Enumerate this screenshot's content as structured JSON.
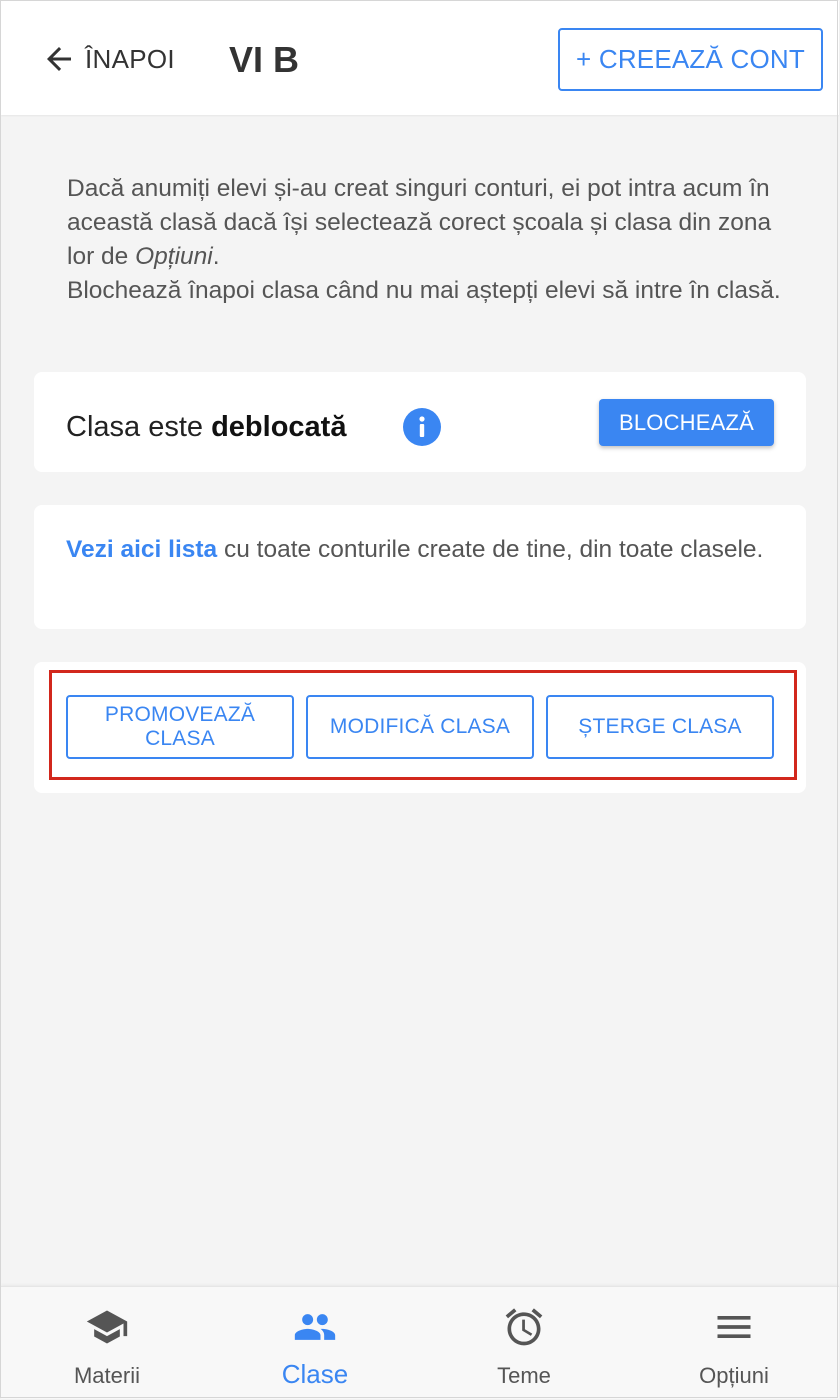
{
  "header": {
    "back_label": "ÎNAPOI",
    "title": "VI B",
    "create_account_label": "+ CREEAZĂ CONT",
    "back_icon": "arrow-left-icon"
  },
  "intro": {
    "line_part1": "Dacă anumiți elevi și-au creat singuri conturi, ei pot intra acum în această clasă dacă își selectează corect școala și clasa din zona lor de ",
    "line_italic": "Opțiuni",
    "line_part2": ".",
    "line2": "Blochează înapoi clasa când nu mai aștepți elevi să intre în clasă."
  },
  "lock_card": {
    "status_prefix": "Clasa este ",
    "status_value": "deblocată",
    "info_icon": "info-icon",
    "block_label": "BLOCHEAZĂ"
  },
  "list_card": {
    "link_text": "Vezi aici lista",
    "rest_text": " cu toate conturile create de tine, din toate clasele."
  },
  "actions": {
    "promote_label": "PROMOVEAZĂ CLASA",
    "modify_label": "MODIFICĂ CLASA",
    "delete_label": "ȘTERGE CLASA"
  },
  "bottom_nav": {
    "items": [
      {
        "label": "Materii",
        "icon": "graduation-cap-icon",
        "active": false
      },
      {
        "label": "Clase",
        "icon": "people-icon",
        "active": true
      },
      {
        "label": "Teme",
        "icon": "alarm-clock-icon",
        "active": false
      },
      {
        "label": "Opțiuni",
        "icon": "menu-icon",
        "active": false
      }
    ]
  },
  "colors": {
    "accent": "#3a86f2",
    "highlight": "#d2271c",
    "background": "#f4f4f4"
  }
}
